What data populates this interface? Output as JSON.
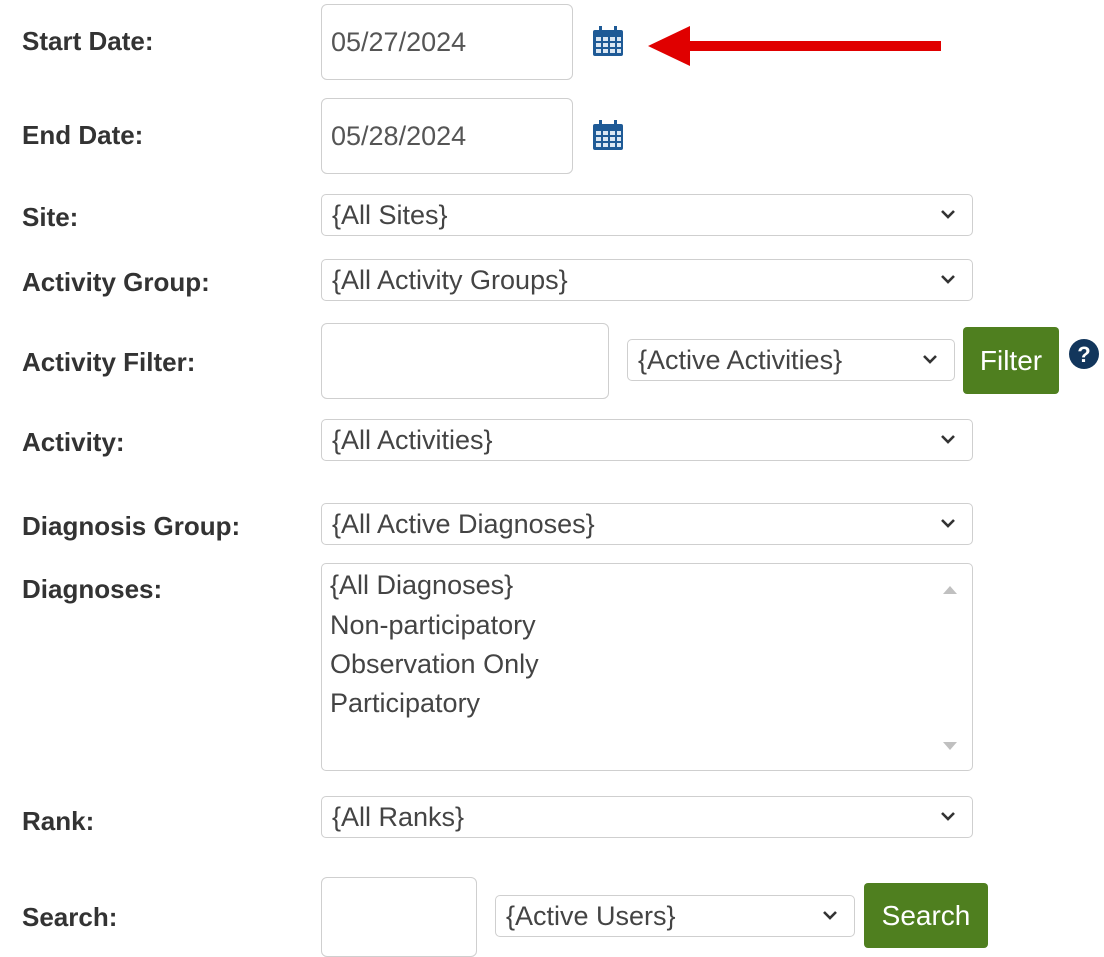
{
  "labels": {
    "start_date": "Start Date:",
    "end_date": "End Date:",
    "site": "Site:",
    "activity_group": "Activity Group:",
    "activity_filter": "Activity Filter:",
    "activity": "Activity:",
    "diagnosis_group": "Diagnosis Group:",
    "diagnoses": "Diagnoses:",
    "rank": "Rank:",
    "search": "Search:"
  },
  "fields": {
    "start_date": "05/27/2024",
    "end_date": "05/28/2024",
    "site": "{All Sites}",
    "activity_group": "{All Activity Groups}",
    "activity_filter_text": "",
    "activity_filter_status": "{Active Activities}",
    "activity": "{All Activities}",
    "diagnosis_group": "{All Active Diagnoses}",
    "rank": "{All Ranks}",
    "search_text": "",
    "search_status": "{Active Users}"
  },
  "diagnoses_options": [
    "{All Diagnoses}",
    "Non-participatory",
    "Observation Only",
    "Participatory"
  ],
  "buttons": {
    "filter": "Filter",
    "search": "Search"
  },
  "icons": {
    "calendar": "calendar-icon",
    "help": "help-icon",
    "arrow": "arrow-left-icon"
  },
  "colors": {
    "button_green": "#4f7f1f",
    "arrow_red": "#e00000",
    "calendar_blue": "#1e5a96"
  }
}
